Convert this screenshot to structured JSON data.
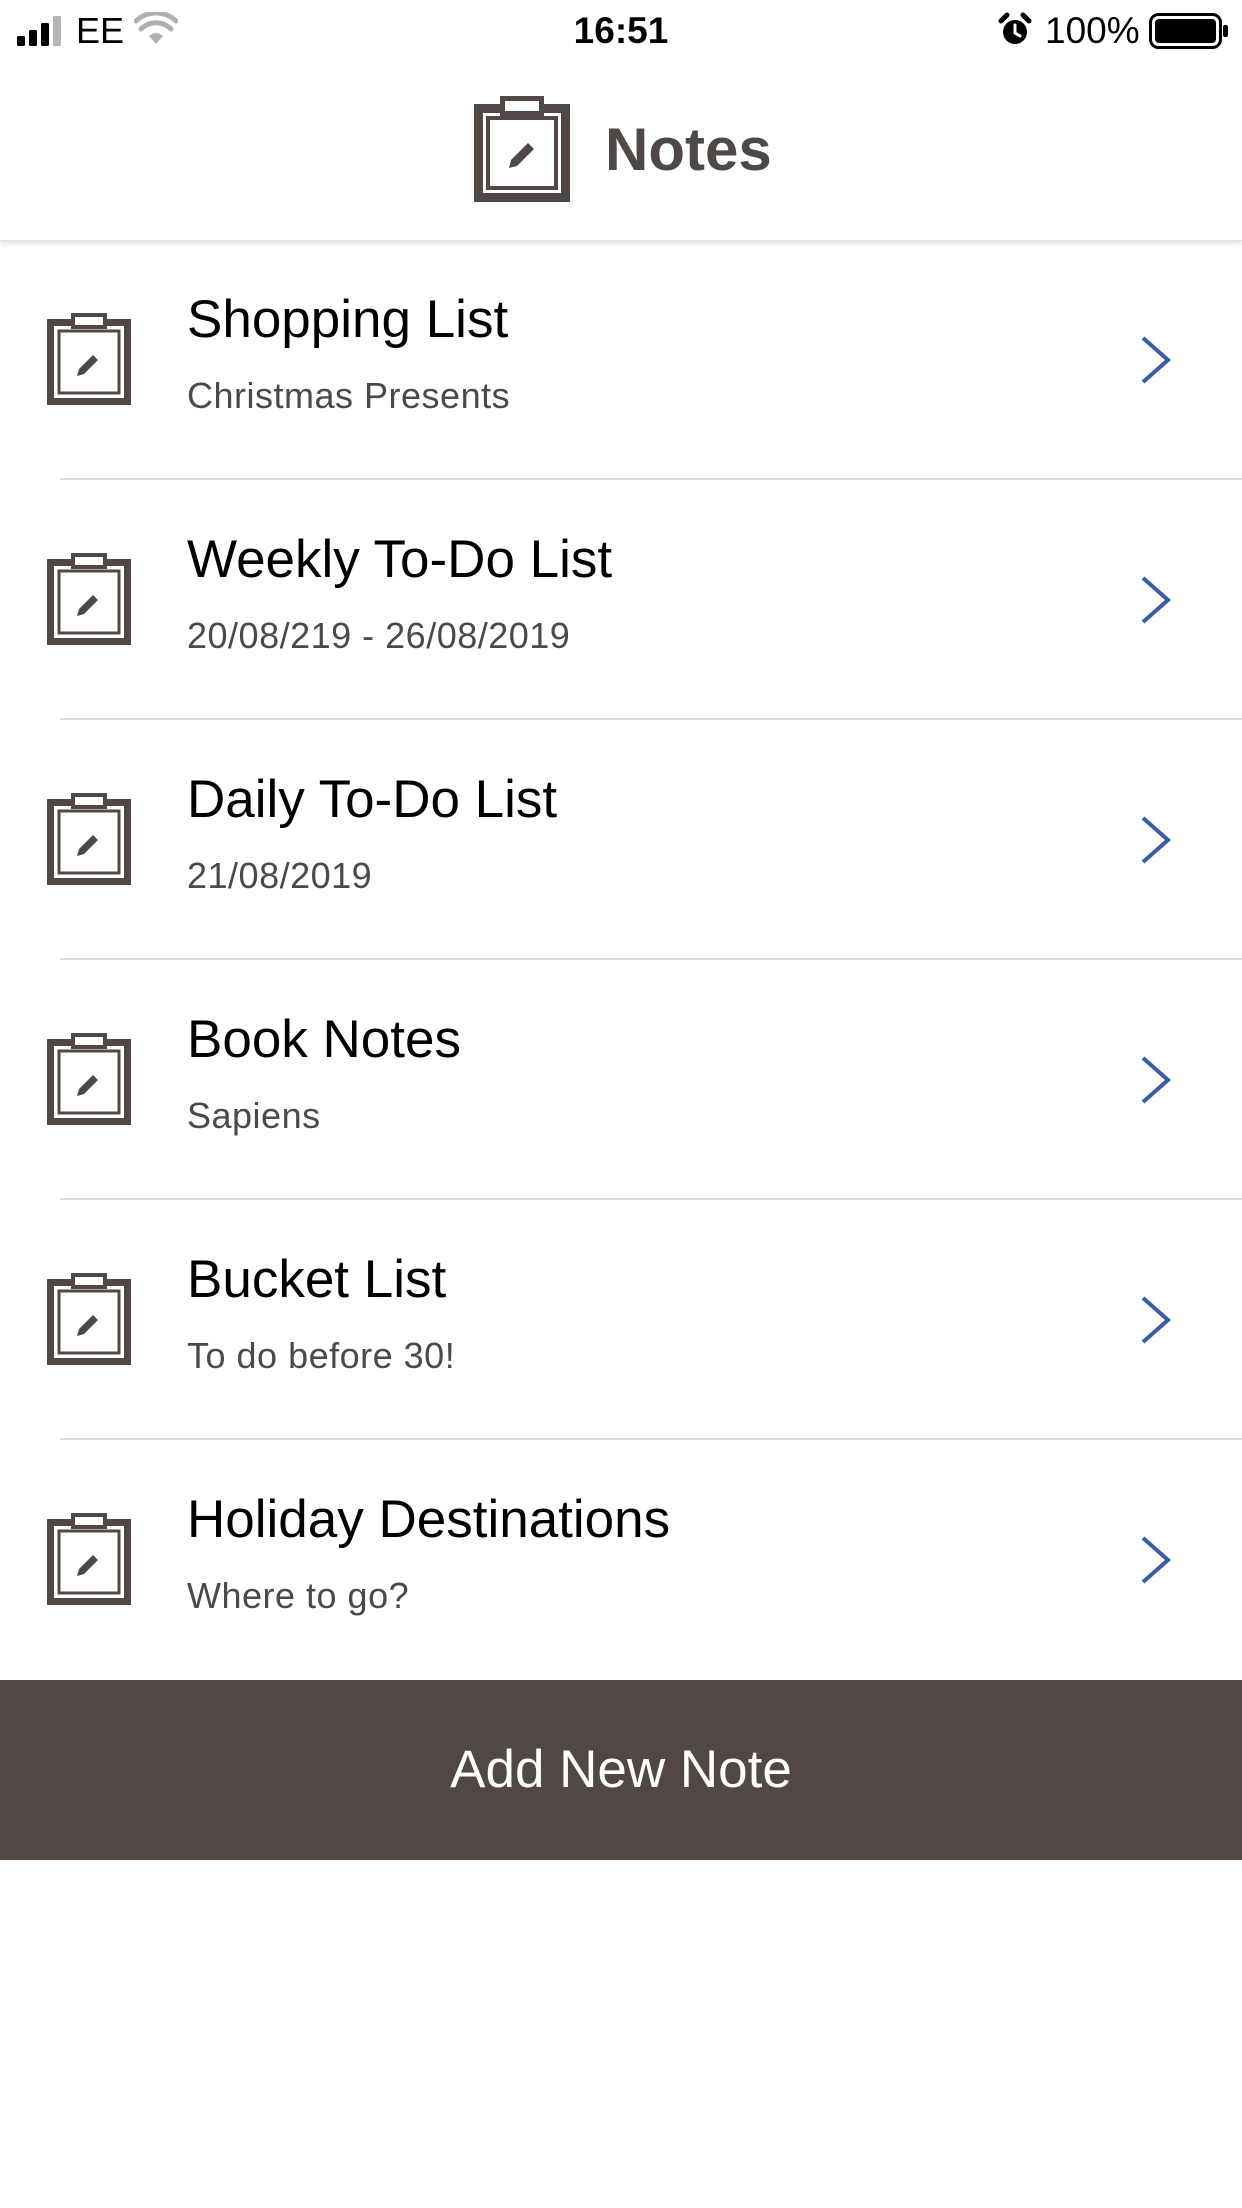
{
  "status_bar": {
    "carrier": "EE",
    "time": "16:51",
    "battery_percent": "100%",
    "battery_level": 1.0,
    "icons": [
      "signal-icon",
      "wifi-icon",
      "alarm-icon",
      "battery-icon"
    ]
  },
  "header": {
    "title": "Notes",
    "icon": "clipboard-pencil-icon"
  },
  "notes": [
    {
      "title": "Shopping List",
      "subtitle": "Christmas Presents"
    },
    {
      "title": "Weekly To-Do List",
      "subtitle": "20/08/219 - 26/08/2019"
    },
    {
      "title": "Daily To-Do List",
      "subtitle": "21/08/2019"
    },
    {
      "title": "Book Notes",
      "subtitle": "Sapiens"
    },
    {
      "title": "Bucket List",
      "subtitle": "To do before 30!"
    },
    {
      "title": "Holiday Destinations",
      "subtitle": "Where to go?"
    }
  ],
  "add_button": {
    "label": "Add New Note"
  },
  "colors": {
    "brand_dark": "#514846",
    "header_title": "#4f4846",
    "chevron": "#3a5ba8",
    "divider": "#dcdcdc",
    "subtitle": "#4a4a4a"
  }
}
